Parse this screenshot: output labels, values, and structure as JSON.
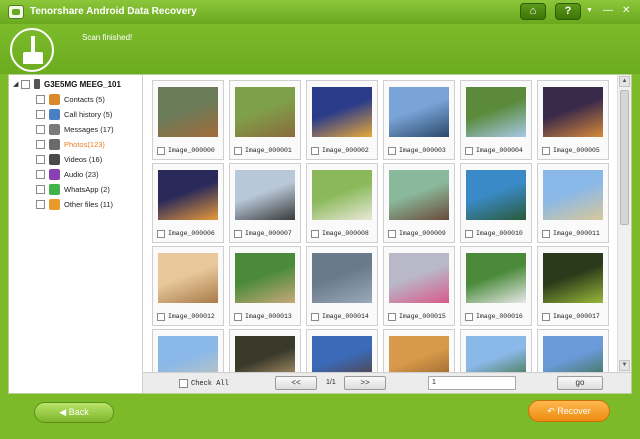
{
  "app": {
    "title": "Tenorshare Android Data Recovery",
    "home_icon": "⌂",
    "help_label": "?",
    "menu_caret": "▼",
    "minimize": "—",
    "close": "✕"
  },
  "status": {
    "message": "Scan finished!"
  },
  "device": {
    "name": "G3E5MG MEEG_101",
    "expander": "◢"
  },
  "categories": [
    {
      "label": "Contacts (5)",
      "icon": "contacts-icon",
      "color": "#d98a2b",
      "selected": false
    },
    {
      "label": "Call history (5)",
      "icon": "phone-icon",
      "color": "#4a7fc4",
      "selected": false
    },
    {
      "label": "Messages (17)",
      "icon": "message-icon",
      "color": "#7a7a7a",
      "selected": false
    },
    {
      "label": "Photos(123)",
      "icon": "photo-icon",
      "color": "#6a6a6a",
      "selected": true
    },
    {
      "label": "Videos (16)",
      "icon": "video-icon",
      "color": "#4a4a4a",
      "selected": false
    },
    {
      "label": "Audio (23)",
      "icon": "audio-icon",
      "color": "#8a3fb3",
      "selected": false
    },
    {
      "label": "WhatsApp (2)",
      "icon": "whatsapp-icon",
      "color": "#3fb34a",
      "selected": false
    },
    {
      "label": "Other files (11)",
      "icon": "file-icon",
      "color": "#e89a2b",
      "selected": false
    }
  ],
  "photos": [
    {
      "name": "Image_000000",
      "c1": "#6a7b5a",
      "c2": "#a26b3a"
    },
    {
      "name": "Image_000001",
      "c1": "#7fa04a",
      "c2": "#8a6a3a"
    },
    {
      "name": "Image_000002",
      "c1": "#2a3b8a",
      "c2": "#e8a83a"
    },
    {
      "name": "Image_000003",
      "c1": "#7aa4d8",
      "c2": "#2a4a6a"
    },
    {
      "name": "Image_000004",
      "c1": "#5a8a3a",
      "c2": "#a8c8e8"
    },
    {
      "name": "Image_000005",
      "c1": "#3a2a4a",
      "c2": "#d88a3a"
    },
    {
      "name": "Image_000006",
      "c1": "#2a2a5a",
      "c2": "#e89a3a"
    },
    {
      "name": "Image_000007",
      "c1": "#b8c8d8",
      "c2": "#3a3a3a"
    },
    {
      "name": "Image_000008",
      "c1": "#8ab85a",
      "c2": "#e8e8d8"
    },
    {
      "name": "Image_000009",
      "c1": "#8ab89a",
      "c2": "#6a4a3a"
    },
    {
      "name": "Image_000010",
      "c1": "#3a8ac8",
      "c2": "#2a5a3a"
    },
    {
      "name": "Image_000011",
      "c1": "#8ab8e8",
      "c2": "#d8c89a"
    },
    {
      "name": "Image_000012",
      "c1": "#e8c89a",
      "c2": "#a87a4a"
    },
    {
      "name": "Image_000013",
      "c1": "#4a8a3a",
      "c2": "#c8a87a"
    },
    {
      "name": "Image_000014",
      "c1": "#6a7a8a",
      "c2": "#9aaaba"
    },
    {
      "name": "Image_000015",
      "c1": "#b8b8c8",
      "c2": "#d85a8a"
    },
    {
      "name": "Image_000016",
      "c1": "#4a8a3a",
      "c2": "#e8e8e8"
    },
    {
      "name": "Image_000017",
      "c1": "#2a3a1a",
      "c2": "#9ab83a"
    },
    {
      "name": "",
      "c1": "#8ab8e8",
      "c2": "#c8c8b8"
    },
    {
      "name": "",
      "c1": "#3a3a2a",
      "c2": "#c8a87a"
    },
    {
      "name": "",
      "c1": "#3a6ab8",
      "c2": "#5a3a2a"
    },
    {
      "name": "",
      "c1": "#d89a4a",
      "c2": "#8a5a2a"
    },
    {
      "name": "",
      "c1": "#8ab8e8",
      "c2": "#3a6a2a"
    },
    {
      "name": "",
      "c1": "#6a9ad8",
      "c2": "#3a6a3a"
    }
  ],
  "pager": {
    "check_all_label": "Check All",
    "prev_label": "<<",
    "page_info": "1/1",
    "next_label": ">>",
    "page_input_value": "1",
    "go_label": "go"
  },
  "footer": {
    "back_label": "◀  Back",
    "recover_label": "↶  Recover"
  }
}
